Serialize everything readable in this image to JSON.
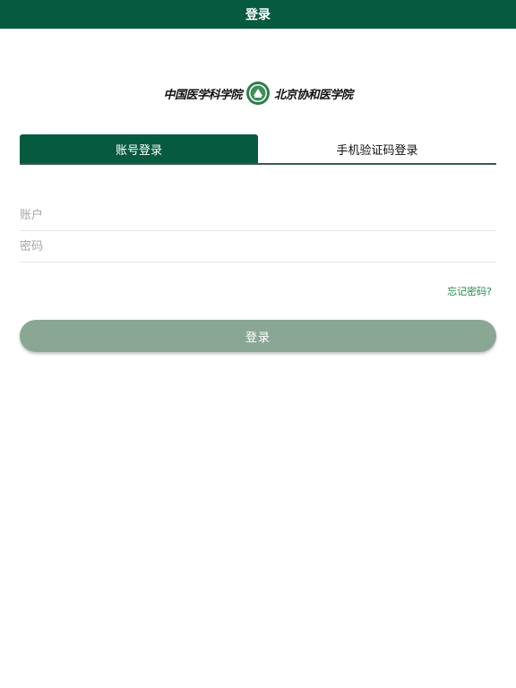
{
  "header": {
    "title": "登录"
  },
  "logo": {
    "left_text": "中国医学科学院",
    "right_text": "北京协和医学院",
    "seal_color": "#2e7d4a"
  },
  "tabs": [
    {
      "label": "账号登录",
      "active": true
    },
    {
      "label": "手机验证码登录",
      "active": false
    }
  ],
  "form": {
    "account": {
      "placeholder": "账户",
      "value": ""
    },
    "password": {
      "placeholder": "密码",
      "value": ""
    },
    "forgot_label": "忘记密码?",
    "submit_label": "登录"
  },
  "colors": {
    "brand": "#065a3f",
    "button": "#8aa796",
    "link": "#1a8a48"
  }
}
